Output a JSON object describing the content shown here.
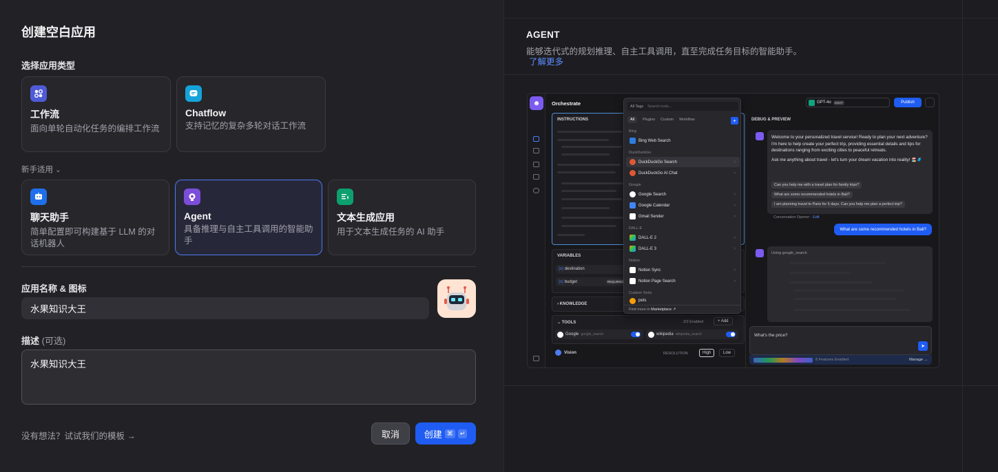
{
  "dialog": {
    "title": "创建空白应用",
    "type_label": "选择应用类型",
    "types": [
      {
        "title": "工作流",
        "desc": "面向单轮自动化任务的编排工作流",
        "color": "#4f5bd5"
      },
      {
        "title": "Chatflow",
        "desc": "支持记忆的复杂多轮对话工作流",
        "color": "#16a3d9"
      }
    ],
    "newbie_label": "新手适用",
    "newbie_types": [
      {
        "title": "聊天助手",
        "desc": "简单配置即可构建基于 LLM 的对话机器人",
        "color": "#1f6feb"
      },
      {
        "title": "Agent",
        "desc": "具备推理与自主工具调用的智能助手",
        "color": "#7c4ddb"
      },
      {
        "title": "文本生成应用",
        "desc": "用于文本生成任务的 AI 助手",
        "color": "#0e9f6e"
      }
    ],
    "name_label": "应用名称 & 图标",
    "name_value": "水果知识大王",
    "desc_label": "描述",
    "desc_optional": "(可选)",
    "desc_value": "水果知识大王",
    "template_link": "没有想法？试试我们的模板",
    "template_arrow": "→",
    "cancel": "取消",
    "create": "创建",
    "create_kbd1": "⌘",
    "create_kbd2": "↵"
  },
  "preview": {
    "title": "AGENT",
    "desc": "能够迭代式的规划推理、自主工具调用，直至完成任务目标的智能助手。",
    "learn_more": "了解更多",
    "mock": {
      "orchestrate": "Orchestrate",
      "model": "GPT-4o",
      "model_tag": "CHAT",
      "publish": "Publish",
      "instructions": "INSTRUCTIONS",
      "debug": "DEBUG & PREVIEW",
      "all_tags": "All Tags",
      "search_placeholder": "Search tools...",
      "tabs": [
        "All",
        "Plugins",
        "Custom",
        "Workflow"
      ],
      "groups": [
        "Bing",
        "DuckDuckGo",
        "Google",
        "DALL-E",
        "Notion",
        "Custom Tools"
      ],
      "tools": [
        "Bing Web Search",
        "DuckDuckGo Search",
        "DuckDuckGo AI Chat",
        "Google Search",
        "Google Calendar",
        "Gmail Sender",
        "DALL-E 2",
        "DALL-E 3",
        "Notion Sync",
        "Notion Page Search",
        "pets"
      ],
      "marketplace": "Find more in",
      "marketplace_link": "Marketplace ↗",
      "variables": "VARIABLES",
      "var1": "destination",
      "var2": "budget",
      "required": "REQUIRED",
      "knowledge": "KNOWLEDGE",
      "tools_label": "TOOLS",
      "tools_enabled": "2/2 Enabled",
      "add": "+ Add",
      "tool1": "Google",
      "tool1_id": "google_search",
      "tool2": "wikipedia",
      "tool2_id": "wikipedia_search",
      "vision": "Vision",
      "resolution": "RESOLUTION",
      "high": "High",
      "low": "Low",
      "welcome": "Welcome to your personalized travel service! Ready to plan your next adventure? I'm here to help create your perfect trip, providing essential details and tips for destinations ranging from exciting cities to peaceful retreats.",
      "ask": "Ask me anything about travel - let's turn your dream vacation into reality! 🏖️🧳",
      "suggestions": [
        "Can you help me with a travel plan for family trips?",
        "What are some recommended hotels in Bali?",
        "I am planning travel to Paris for 5 days. Can you help me plan a perfect trip?"
      ],
      "opener": "Conversation Opener",
      "edit": "Edit",
      "user_msg": "What are some recommended hotels in Bali?",
      "using": "Using",
      "using_tool": "google_search",
      "input": "What's the price?",
      "features": "8 Features Enabled",
      "manage": "Manage →"
    }
  }
}
